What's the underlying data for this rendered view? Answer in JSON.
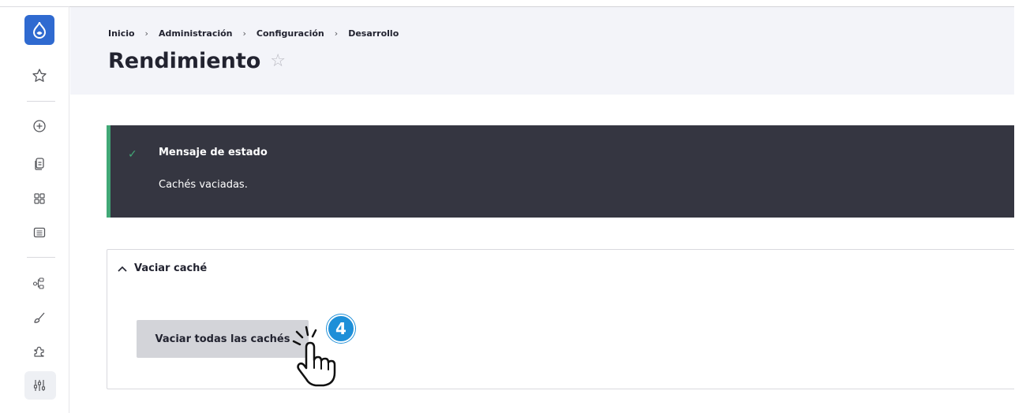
{
  "breadcrumb": {
    "items": [
      "Inicio",
      "Administración",
      "Configuración",
      "Desarrollo"
    ],
    "separator": "›"
  },
  "page": {
    "title": "Rendimiento",
    "favorite_icon": "star-outline-icon"
  },
  "status_message": {
    "title": "Mensaje de estado",
    "text": "Cachés vaciadas.",
    "icon": "check-icon"
  },
  "clear_cache": {
    "summary": "Vaciar caché",
    "button_label": "Vaciar todas las cachés"
  },
  "annotation": {
    "step_number": "4"
  },
  "sidebar": {
    "icons": [
      "drupal-logo-icon",
      "star-icon",
      "add-content-icon",
      "content-icon",
      "structure-icon",
      "reports-icon",
      "workflow-icon",
      "appearance-icon",
      "extend-icon",
      "configuration-icon"
    ]
  },
  "colors": {
    "logo_blue": "#2f6ad0",
    "status_bg": "#353641",
    "status_accent": "#42a877",
    "button_bg": "#d3d4d9",
    "badge_blue": "#1e8fd8"
  }
}
